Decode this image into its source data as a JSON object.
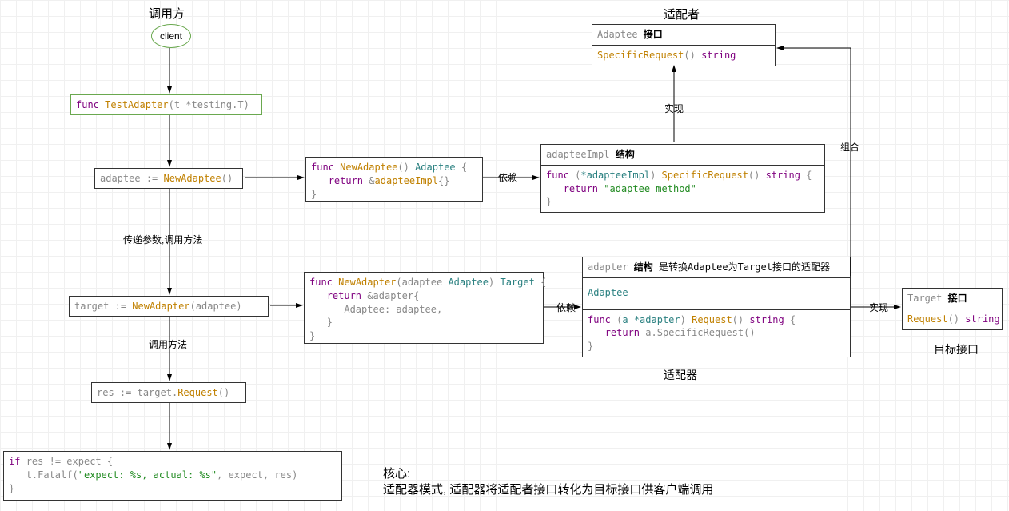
{
  "labels": {
    "caller": "调用方",
    "client": "client",
    "adaptee_role": "适配者",
    "adapter_role": "适配器",
    "target_role": "目标接口",
    "pass_params": "传递参数,调用方法",
    "call_method": "调用方法",
    "impl": "实现",
    "compose": "组合",
    "depend": "依赖",
    "core_title": "核心:",
    "core_desc": "适配器模式, 适配器将适配者接口转化为目标接口供客户端调用"
  },
  "adaptee_iface": {
    "header_pre": "Adaptee ",
    "header_bold": "接口",
    "sig_fn": "SpecificRequest",
    "sig_ret": "string"
  },
  "target_iface": {
    "header_pre": "Target ",
    "header_bold": "接口",
    "sig_fn": "Request",
    "sig_ret": "string"
  },
  "adaptee_impl": {
    "header_pre": "adapteeImpl ",
    "header_bold": "结构",
    "fn_recv": "*adapteeImpl",
    "fn_name": "SpecificRequest",
    "fn_ret": "string",
    "ret_str": "\"adaptee method\""
  },
  "adapter_box": {
    "header_pre": "adapter ",
    "header_bold": "结构",
    "header_desc": " 是转换Adaptee为Target接口的适配器",
    "embed": "Adaptee",
    "fn_recv": "a *adapter",
    "fn_name": "Request",
    "fn_ret": "string",
    "ret_expr": "a.SpecificRequest()"
  },
  "func_test": {
    "name": "TestAdapter",
    "param": "t *testing.T"
  },
  "assign_adaptee": {
    "var": "adaptee",
    "call": "NewAdaptee"
  },
  "func_newadaptee": {
    "name": "NewAdaptee",
    "ret": "Adaptee",
    "struct": "adapteeImpl"
  },
  "assign_target": {
    "var": "target",
    "call": "NewAdapter",
    "arg": "adaptee"
  },
  "func_newadapter": {
    "name": "NewAdapter",
    "param_name": "adaptee",
    "param_ty": "Adaptee",
    "ret": "Target",
    "struct": "adapter",
    "field": "Adaptee",
    "field_val": "adaptee"
  },
  "assign_res": {
    "var": "res",
    "obj": "target",
    "meth": "Request"
  },
  "if_block": {
    "cond_left": "res",
    "cond_right": "expect",
    "fatalf": "t.Fatalf",
    "fmt_str": "\"expect: %s, actual: %s\"",
    "arg1": "expect",
    "arg2": "res"
  }
}
